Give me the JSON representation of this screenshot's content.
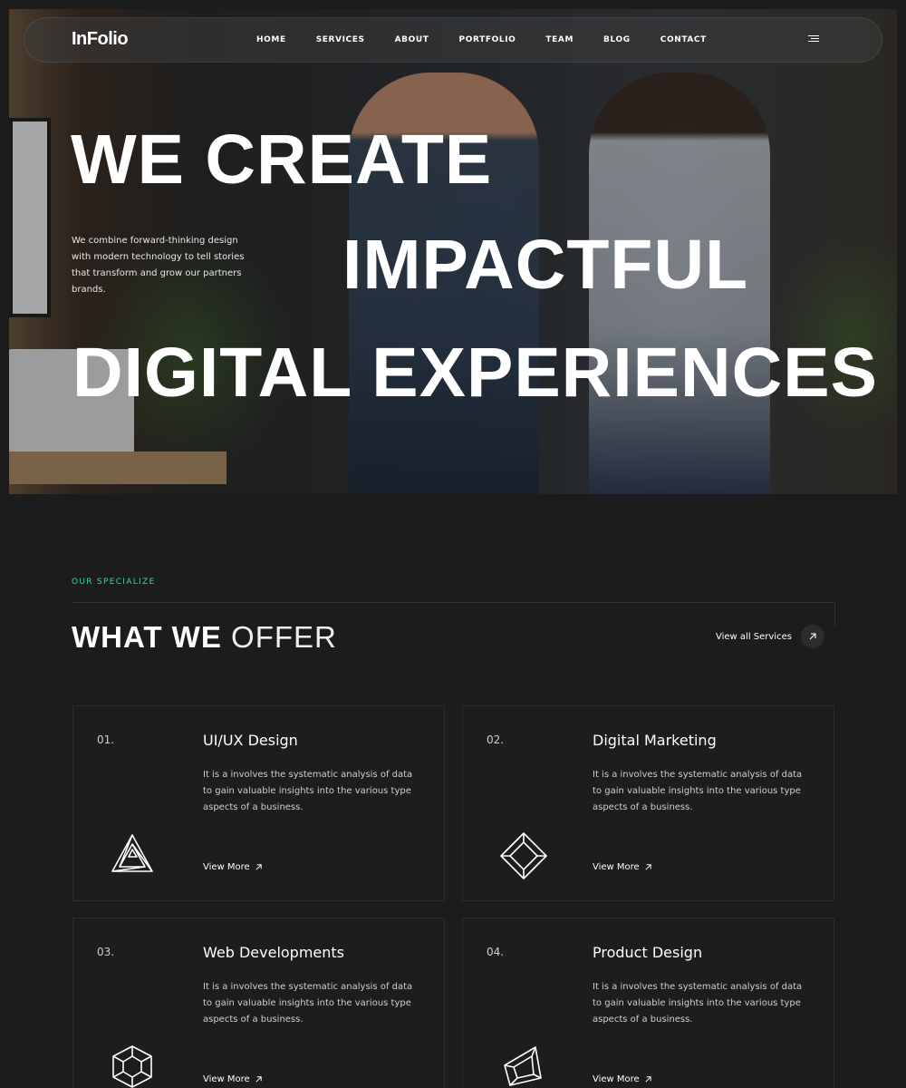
{
  "brand": {
    "logo": "InFolio",
    "accent_color": "#3ed6a0"
  },
  "nav": {
    "items": [
      {
        "label": "HOME"
      },
      {
        "label": "SERVICES"
      },
      {
        "label": "ABOUT"
      },
      {
        "label": "PORTFOLIO"
      },
      {
        "label": "TEAM"
      },
      {
        "label": "BLOG"
      },
      {
        "label": "CONTACT"
      }
    ],
    "menu_icon": "hamburger-menu-icon"
  },
  "hero": {
    "line1": "WE CREATE",
    "line2": "IMPACTFUL",
    "line3": "DIGITAL EXPERIENCES",
    "description": "We combine forward-thinking design with modern technology to tell stories that transform and grow our partners brands."
  },
  "offer": {
    "eyebrow": "OUR SPECIALIZE",
    "title_strong": "WHAT WE",
    "title_light": "OFFER",
    "view_all": "View all Services",
    "view_all_icon": "arrow-up-right-icon",
    "cards": [
      {
        "num": "01.",
        "title": "UI/UX Design",
        "desc": "It is a involves the systematic analysis of data to gain valuable insights into the various type aspects of a business.",
        "link": "View More",
        "icon": "impossible-triangle-icon"
      },
      {
        "num": "02.",
        "title": "Digital Marketing",
        "desc": "It is a involves the systematic analysis of data to gain valuable insights into the various type aspects of a business.",
        "link": "View More",
        "icon": "impossible-square-icon"
      },
      {
        "num": "03.",
        "title": "Web Developments",
        "desc": "It is a involves the systematic analysis of data to gain valuable insights into the various type aspects of a business.",
        "link": "View More",
        "icon": "impossible-cube-icon"
      },
      {
        "num": "04.",
        "title": "Product Design",
        "desc": "It is a involves the systematic analysis of data to gain valuable insights into the various type aspects of a business.",
        "link": "View More",
        "icon": "impossible-shape-icon"
      }
    ]
  }
}
